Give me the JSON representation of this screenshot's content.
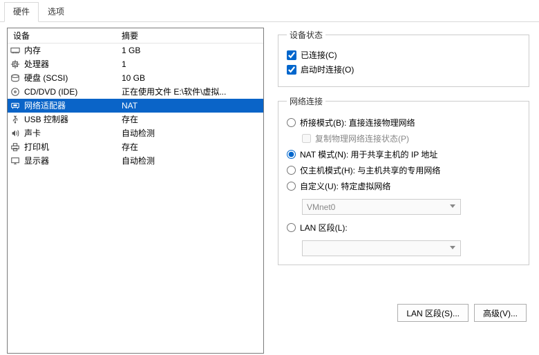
{
  "tabs": {
    "hardware": "硬件",
    "options": "选项"
  },
  "columns": {
    "device": "设备",
    "summary": "摘要"
  },
  "devices": [
    {
      "name": "内存",
      "summary": "1 GB",
      "icon": "memory"
    },
    {
      "name": "处理器",
      "summary": "1",
      "icon": "cpu"
    },
    {
      "name": "硬盘 (SCSI)",
      "summary": "10 GB",
      "icon": "disk"
    },
    {
      "name": "CD/DVD (IDE)",
      "summary": "正在使用文件 E:\\软件\\虚拟...",
      "icon": "cd"
    },
    {
      "name": "网络适配器",
      "summary": "NAT",
      "icon": "net"
    },
    {
      "name": "USB 控制器",
      "summary": "存在",
      "icon": "usb"
    },
    {
      "name": "声卡",
      "summary": "自动检测",
      "icon": "sound"
    },
    {
      "name": "打印机",
      "summary": "存在",
      "icon": "printer"
    },
    {
      "name": "显示器",
      "summary": "自动检测",
      "icon": "display"
    }
  ],
  "selectedIndex": 4,
  "status": {
    "legend": "设备状态",
    "connected": "已连接(C)",
    "connectedChecked": true,
    "connectAtPower": "启动时连接(O)",
    "connectAtPowerChecked": true
  },
  "netconn": {
    "legend": "网络连接",
    "bridged": "桥接模式(B): 直接连接物理网络",
    "replicate": "复制物理网络连接状态(P)",
    "nat": "NAT 模式(N): 用于共享主机的 IP 地址",
    "hostonly": "仅主机模式(H): 与主机共享的专用网络",
    "custom": "自定义(U): 特定虚拟网络",
    "customCombo": "VMnet0",
    "lan": "LAN 区段(L):",
    "lanCombo": "",
    "selected": "nat"
  },
  "buttons": {
    "lanSegments": "LAN 区段(S)...",
    "advanced": "高级(V)..."
  }
}
